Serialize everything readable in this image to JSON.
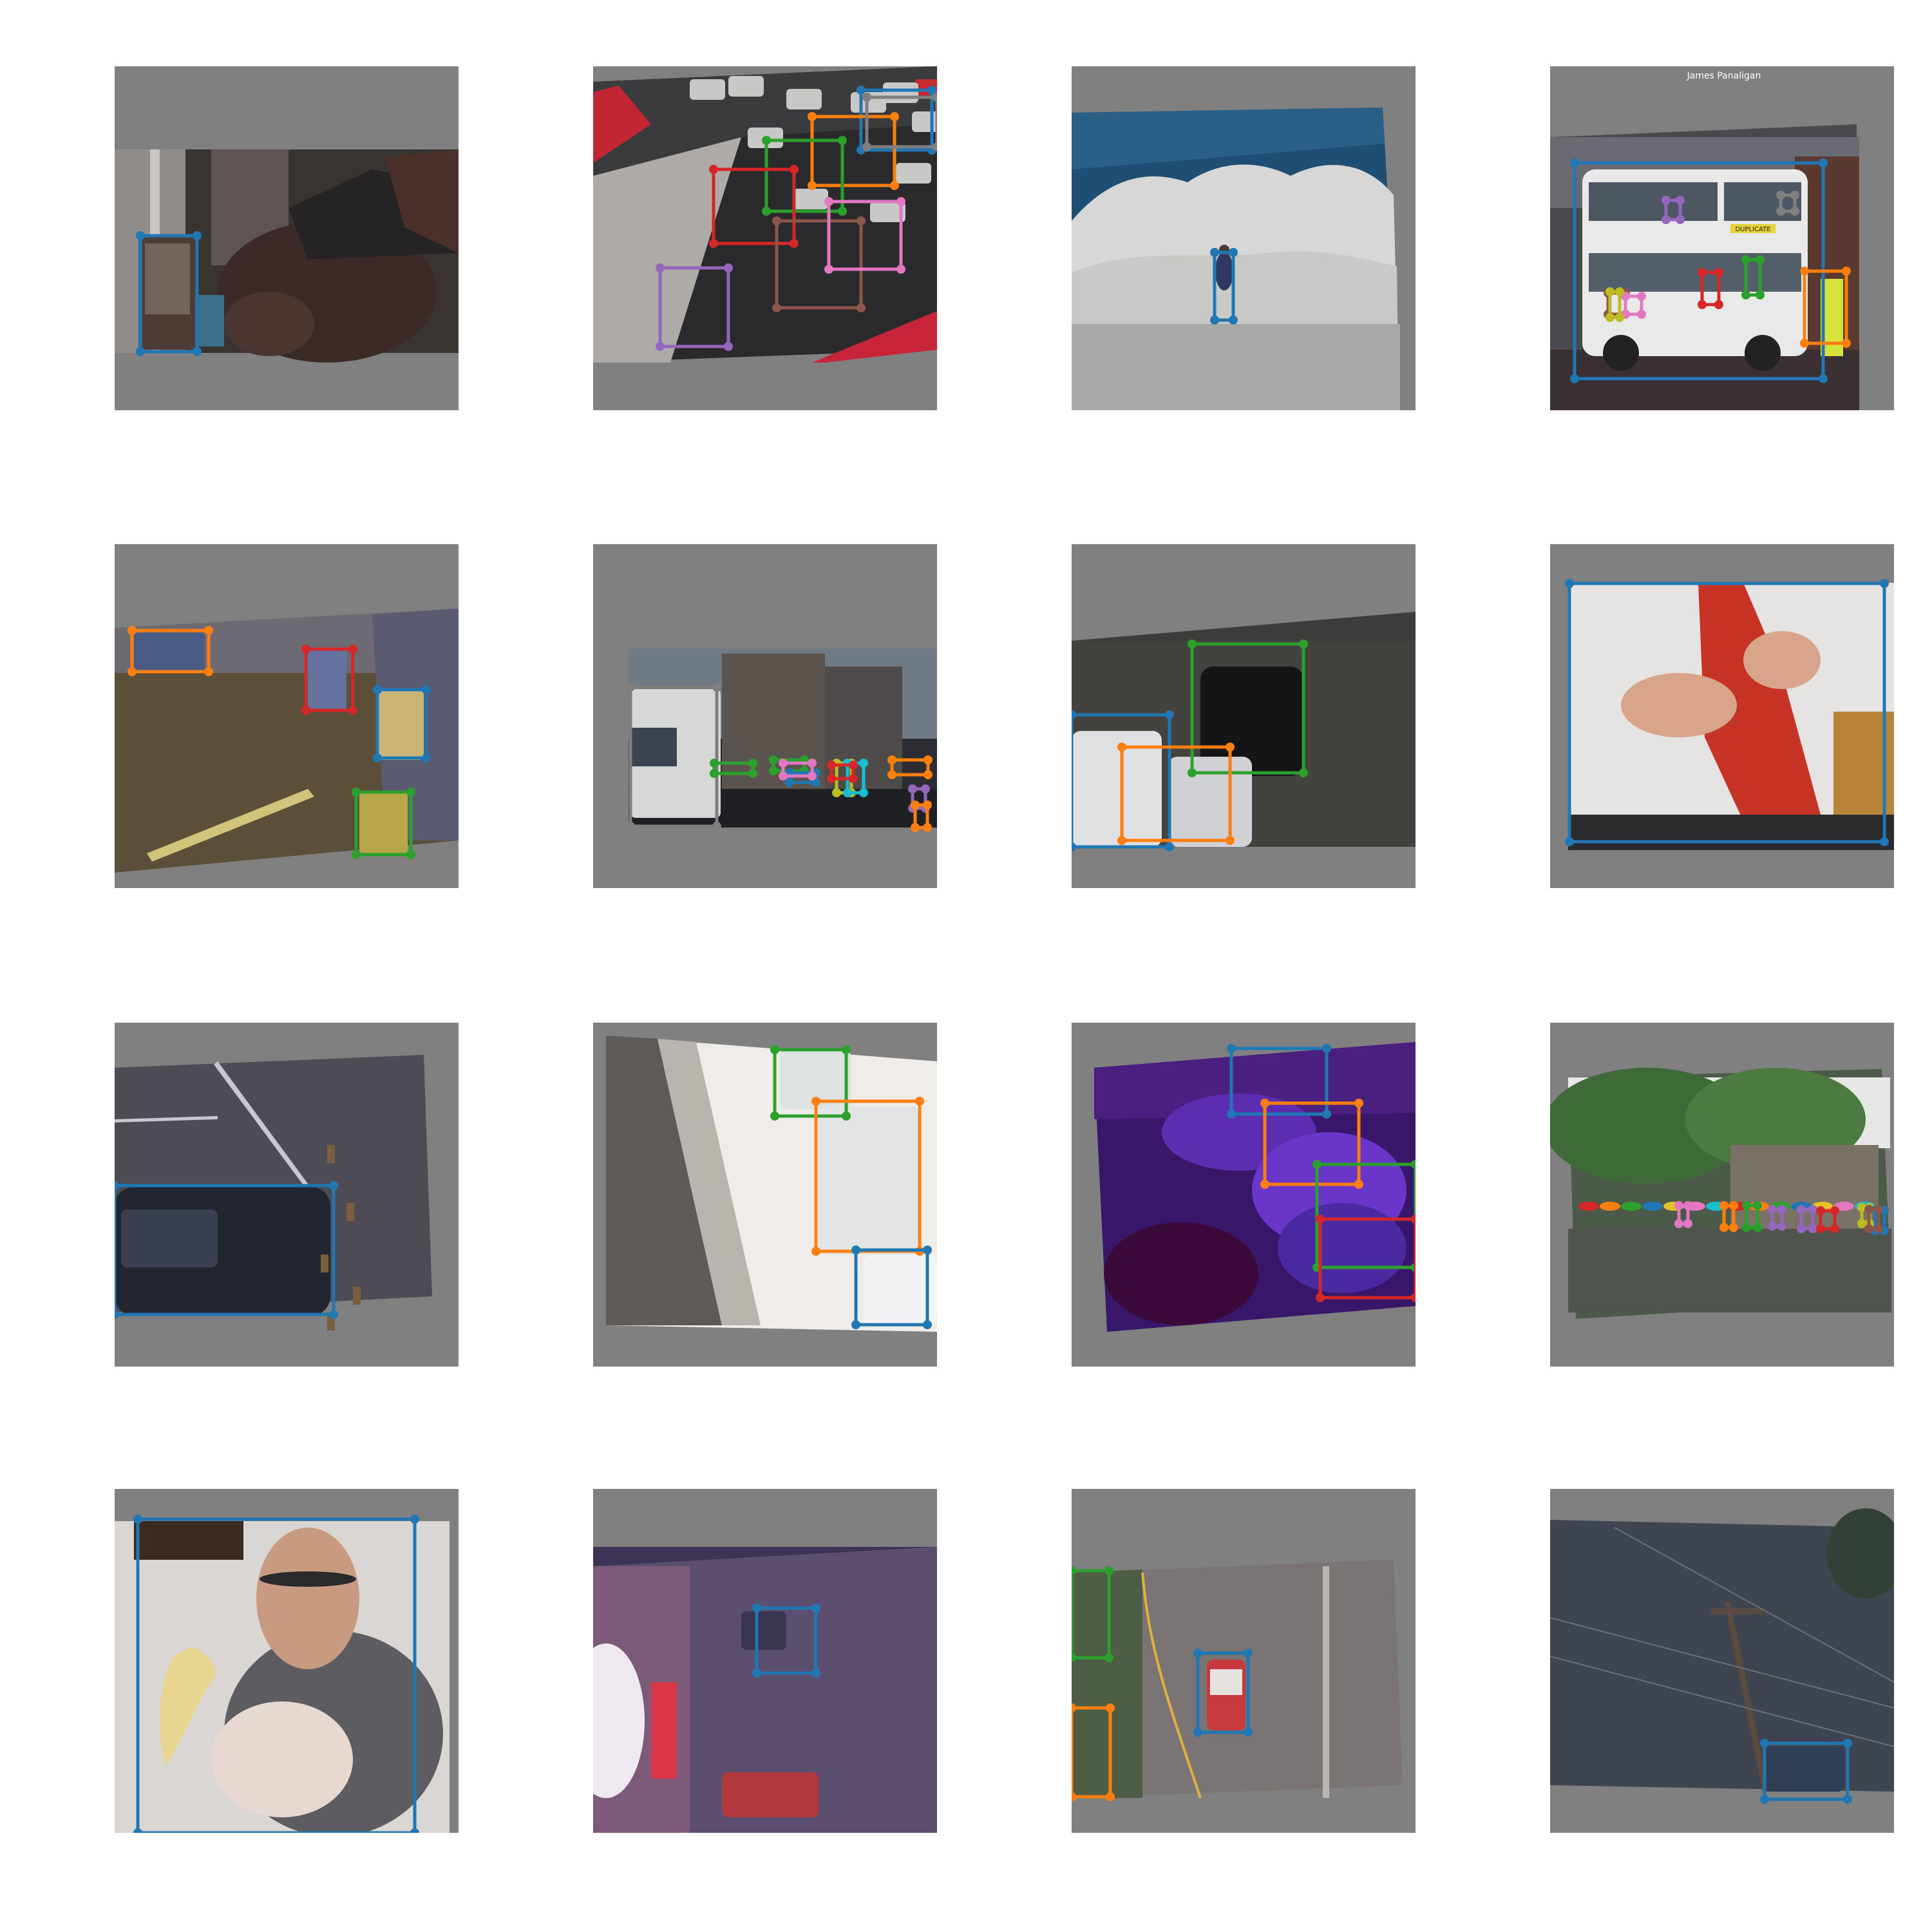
{
  "colors": {
    "background": "#ffffff",
    "padding": "#808080",
    "palette": [
      "#1f77b4",
      "#ff7f0e",
      "#2ca02c",
      "#d62728",
      "#9467bd",
      "#8c564b",
      "#e377c2",
      "#7f7f7f",
      "#bcbd22",
      "#17becf"
    ]
  },
  "grid": {
    "rows": 4,
    "columns": 4
  },
  "tiles": [
    {
      "id": "t1",
      "scene": "aerial-street-truck",
      "box_count": 1
    },
    {
      "id": "t2",
      "scene": "aerial-parking-lot",
      "box_count": 8
    },
    {
      "id": "t3",
      "scene": "surfer-in-wave",
      "box_count": 1
    },
    {
      "id": "t4",
      "scene": "double-decker-bus",
      "box_count": 8,
      "printed_text": {
        "photographer": "James Panaligan",
        "sub": "",
        "bus_sign": "DUPLICATE"
      }
    },
    {
      "id": "t5",
      "scene": "aerial-night-street",
      "box_count": 4
    },
    {
      "id": "t6",
      "scene": "city-street-bus",
      "box_count": 11
    },
    {
      "id": "t7",
      "scene": "aerial-parked-cars",
      "box_count": 3
    },
    {
      "id": "t8",
      "scene": "man-holding-red-tie",
      "box_count": 1
    },
    {
      "id": "t9",
      "scene": "aerial-parking-car",
      "box_count": 1
    },
    {
      "id": "t10",
      "scene": "aerial-road-vans",
      "box_count": 3
    },
    {
      "id": "t11",
      "scene": "purple-blurry-cars",
      "box_count": 4
    },
    {
      "id": "t12",
      "scene": "riverwalk-umbrellas",
      "box_count": 9
    },
    {
      "id": "t13",
      "scene": "man-with-banana",
      "box_count": 1
    },
    {
      "id": "t14",
      "scene": "night-street-signs",
      "box_count": 1
    },
    {
      "id": "t15",
      "scene": "aerial-road-taxi",
      "box_count": 3
    },
    {
      "id": "t16",
      "scene": "aerial-road-pole",
      "box_count": 1
    }
  ]
}
